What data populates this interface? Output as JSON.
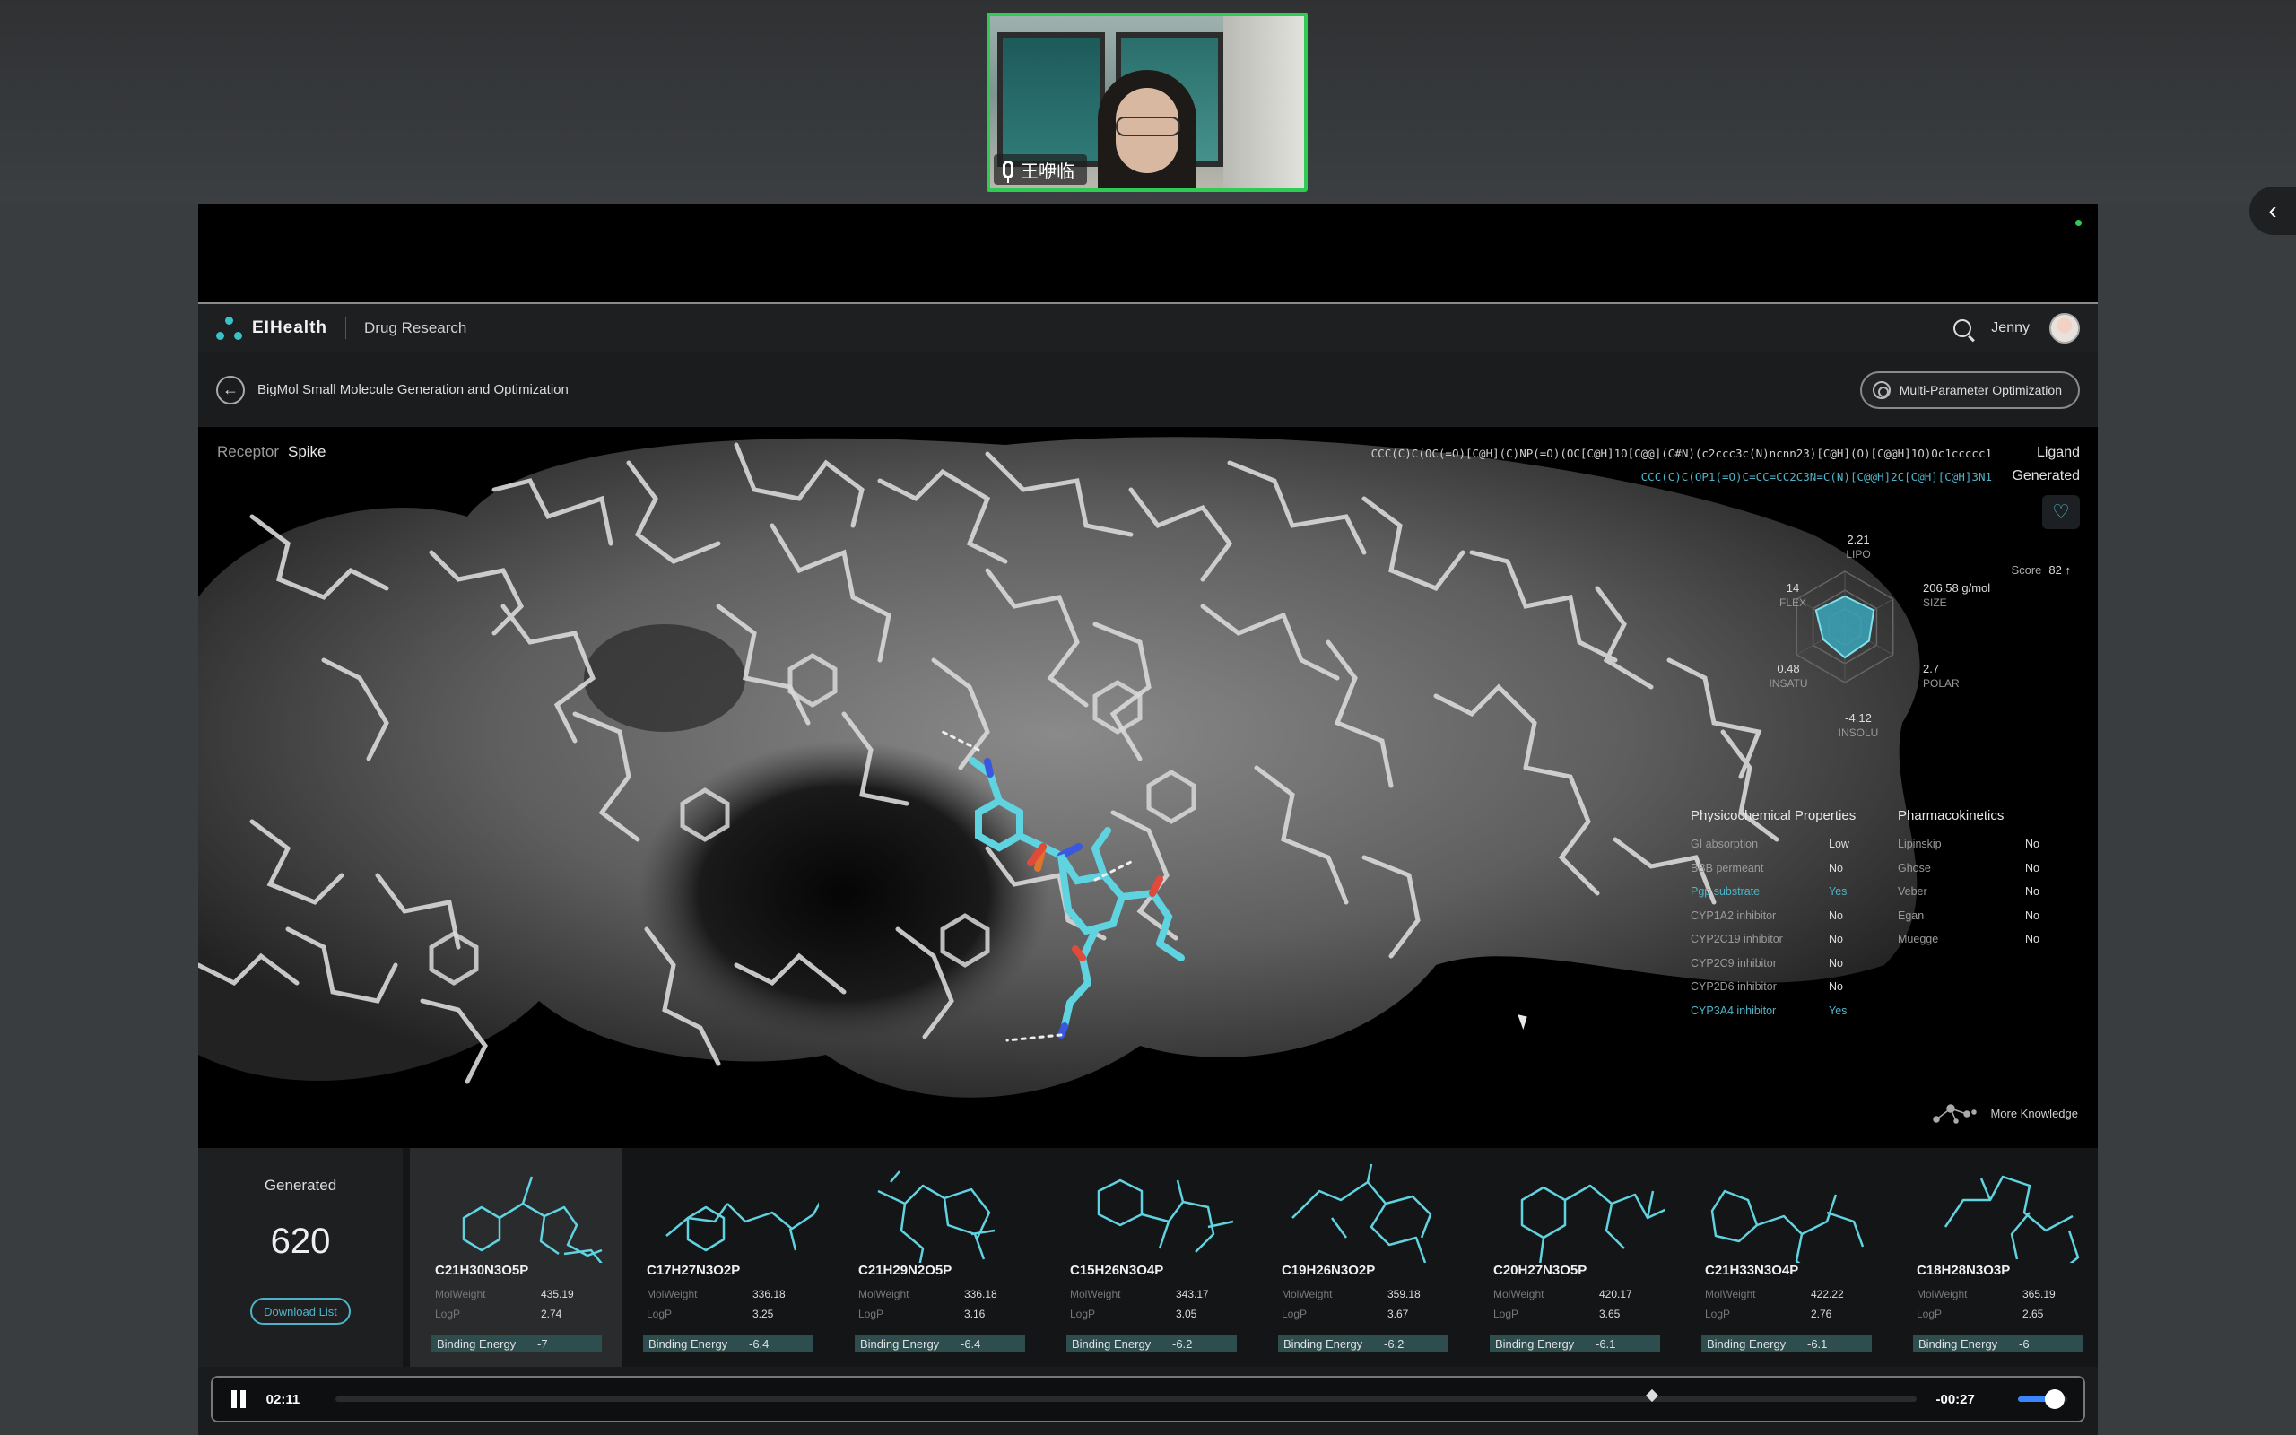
{
  "meeting": {
    "participant_name": "王咿临"
  },
  "app": {
    "brand": "EIHealth",
    "section": "Drug Research",
    "user_name": "Jenny",
    "page_title": "BigMol Small Molecule Generation and Optimization",
    "mpo_button": "Multi-Parameter Optimization"
  },
  "viewer": {
    "receptor_label": "Receptor",
    "receptor_value": "Spike",
    "smiles_ligand": "CCC(C)C(OC(=O)[C@H](C)NP(=O)(OC[C@H]1O[C@@](C#N)(c2ccc3c(N)ncnn23)[C@H](O)[C@@H]1O)Oc1ccccc1",
    "smiles_generated": "CCC(C)C(OP1(=O)C=CC=CC2C3N=C(N)[C@@H]2C[C@H][C@H]3N1",
    "ligand_label": "Ligand",
    "generated_label": "Generated",
    "score_label": "Score",
    "score_value": "82",
    "more_knowledge": "More Knowledge"
  },
  "radar": {
    "axes": [
      {
        "name": "LIPO",
        "value": "2.21",
        "level": 0.55
      },
      {
        "name": "SIZE",
        "value": "206.58 g/mol",
        "level": 0.6
      },
      {
        "name": "POLAR",
        "value": "2.7",
        "level": 0.5
      },
      {
        "name": "INSOLU",
        "value": "-4.12",
        "level": 0.55
      },
      {
        "name": "INSATU",
        "value": "0.48",
        "level": 0.45
      },
      {
        "name": "FLEX",
        "value": "14",
        "level": 0.6
      }
    ]
  },
  "physchem": {
    "title": "Physicochemical Properties",
    "rows": [
      {
        "label": "GI absorption",
        "value": "Low",
        "highlight": false
      },
      {
        "label": "BBB permeant",
        "value": "No",
        "highlight": false
      },
      {
        "label": "Pgp substrate",
        "value": "Yes",
        "highlight": true
      },
      {
        "label": "CYP1A2 inhibitor",
        "value": "No",
        "highlight": false
      },
      {
        "label": "CYP2C19 inhibitor",
        "value": "No",
        "highlight": false
      },
      {
        "label": "CYP2C9 inhibitor",
        "value": "No",
        "highlight": false
      },
      {
        "label": "CYP2D6 inhibitor",
        "value": "No",
        "highlight": false
      },
      {
        "label": "CYP3A4 inhibitor",
        "value": "Yes",
        "highlight": true
      }
    ]
  },
  "pharma": {
    "title": "Pharmacokinetics",
    "rows": [
      {
        "label": "Lipinskip",
        "value": "No"
      },
      {
        "label": "Ghose",
        "value": "No"
      },
      {
        "label": "Veber",
        "value": "No"
      },
      {
        "label": "Egan",
        "value": "No"
      },
      {
        "label": "Muegge",
        "value": "No"
      }
    ]
  },
  "generated": {
    "title": "Generated",
    "count": "620",
    "download_label": "Download List"
  },
  "molecule_labels": {
    "mol_weight": "MolWeight",
    "logp": "LogP",
    "binding": "Binding Energy"
  },
  "molecules": [
    {
      "formula": "C21H30N3O5P",
      "mol_weight": "435.19",
      "logp": "2.74",
      "binding_energy": "-7"
    },
    {
      "formula": "C17H27N3O2P",
      "mol_weight": "336.18",
      "logp": "3.25",
      "binding_energy": "-6.4"
    },
    {
      "formula": "C21H29N2O5P",
      "mol_weight": "336.18",
      "logp": "3.16",
      "binding_energy": "-6.4"
    },
    {
      "formula": "C15H26N3O4P",
      "mol_weight": "343.17",
      "logp": "3.05",
      "binding_energy": "-6.2"
    },
    {
      "formula": "C19H26N3O2P",
      "mol_weight": "359.18",
      "logp": "3.67",
      "binding_energy": "-6.2"
    },
    {
      "formula": "C20H27N3O5P",
      "mol_weight": "420.17",
      "logp": "3.65",
      "binding_energy": "-6.1"
    },
    {
      "formula": "C21H33N3O4P",
      "mol_weight": "422.22",
      "logp": "2.76",
      "binding_energy": "-6.1"
    },
    {
      "formula": "C18H28N3O3P",
      "mol_weight": "365.19",
      "logp": "2.65",
      "binding_energy": "-6"
    }
  ],
  "player": {
    "current_time": "02:11",
    "remaining_time": "-00:27",
    "progress": 0.83,
    "volume": 0.7
  },
  "colors": {
    "accent": "#4fb3c7",
    "ligand": "#5fd3e0",
    "tile_border": "#2ecc52"
  }
}
